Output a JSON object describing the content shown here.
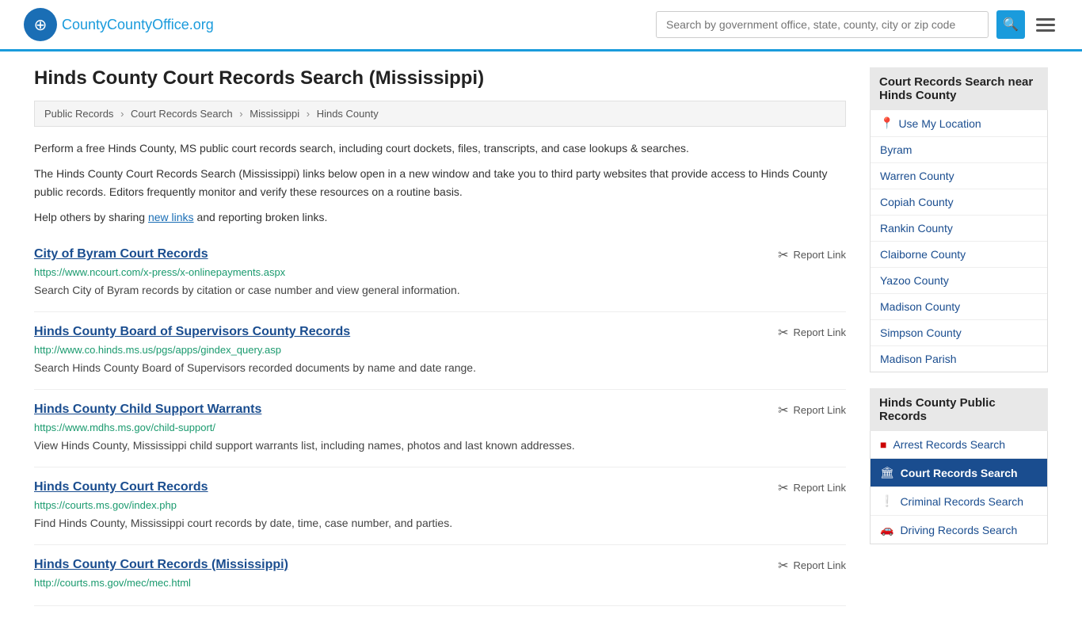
{
  "header": {
    "logo_text": "CountyOffice",
    "logo_tld": ".org",
    "search_placeholder": "Search by government office, state, county, city or zip code",
    "search_icon": "🔍",
    "menu_icon": "☰"
  },
  "page": {
    "title": "Hinds County Court Records Search (Mississippi)",
    "breadcrumb": {
      "items": [
        "Public Records",
        "Court Records Search",
        "Mississippi",
        "Hinds County"
      ]
    },
    "description_1": "Perform a free Hinds County, MS public court records search, including court dockets, files, transcripts, and case lookups & searches.",
    "description_2": "The Hinds County Court Records Search (Mississippi) links below open in a new window and take you to third party websites that provide access to Hinds County public records. Editors frequently monitor and verify these resources on a routine basis.",
    "description_3_pre": "Help others by sharing ",
    "new_links_text": "new links",
    "description_3_post": " and reporting broken links."
  },
  "results": [
    {
      "title": "City of Byram Court Records",
      "url": "https://www.ncourt.com/x-press/x-onlinepayments.aspx",
      "description": "Search City of Byram records by citation or case number and view general information.",
      "report_label": "Report Link"
    },
    {
      "title": "Hinds County Board of Supervisors County Records",
      "url": "http://www.co.hinds.ms.us/pgs/apps/gindex_query.asp",
      "description": "Search Hinds County Board of Supervisors recorded documents by name and date range.",
      "report_label": "Report Link"
    },
    {
      "title": "Hinds County Child Support Warrants",
      "url": "https://www.mdhs.ms.gov/child-support/",
      "description": "View Hinds County, Mississippi child support warrants list, including names, photos and last known addresses.",
      "report_label": "Report Link"
    },
    {
      "title": "Hinds County Court Records",
      "url": "https://courts.ms.gov/index.php",
      "description": "Find Hinds County, Mississippi court records by date, time, case number, and parties.",
      "report_label": "Report Link"
    },
    {
      "title": "Hinds County Court Records (Mississippi)",
      "url": "http://courts.ms.gov/mec/mec.html",
      "description": "",
      "report_label": "Report Link"
    }
  ],
  "sidebar": {
    "nearby_title": "Court Records Search near Hinds County",
    "nearby_links": [
      {
        "text": "Use My Location",
        "type": "location"
      },
      {
        "text": "Byram"
      },
      {
        "text": "Warren County"
      },
      {
        "text": "Copiah County"
      },
      {
        "text": "Rankin County"
      },
      {
        "text": "Claiborne County"
      },
      {
        "text": "Yazoo County"
      },
      {
        "text": "Madison County"
      },
      {
        "text": "Simpson County"
      },
      {
        "text": "Madison Parish"
      }
    ],
    "public_records_title": "Hinds County Public Records",
    "public_records_links": [
      {
        "text": "Arrest Records Search",
        "icon": "■",
        "icon_color": "red",
        "active": false
      },
      {
        "text": "Court Records Search",
        "icon": "⊞",
        "icon_color": "dark",
        "active": true
      },
      {
        "text": "Criminal Records Search",
        "icon": "!",
        "icon_color": "orange",
        "active": false
      },
      {
        "text": "Driving Records Search",
        "icon": "🚗",
        "icon_color": "dark",
        "active": false
      }
    ]
  }
}
